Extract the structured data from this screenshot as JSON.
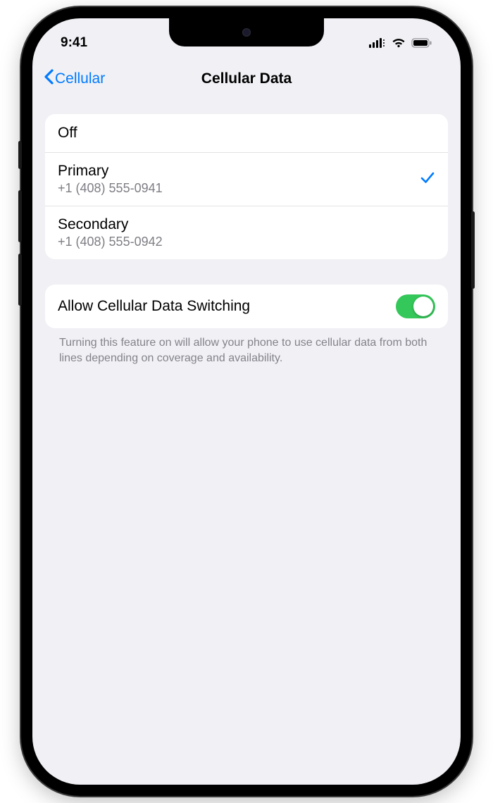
{
  "status": {
    "time": "9:41"
  },
  "nav": {
    "back": "Cellular",
    "title": "Cellular Data"
  },
  "lines": [
    {
      "title": "Off",
      "sub": "",
      "selected": false
    },
    {
      "title": "Primary",
      "sub": "+1 (408) 555-0941",
      "selected": true
    },
    {
      "title": "Secondary",
      "sub": "+1 (408) 555-0942",
      "selected": false
    }
  ],
  "switching": {
    "label": "Allow Cellular Data Switching",
    "on": true,
    "description": "Turning this feature on will allow your phone to use cellular data from both lines depending on coverage and availability."
  }
}
